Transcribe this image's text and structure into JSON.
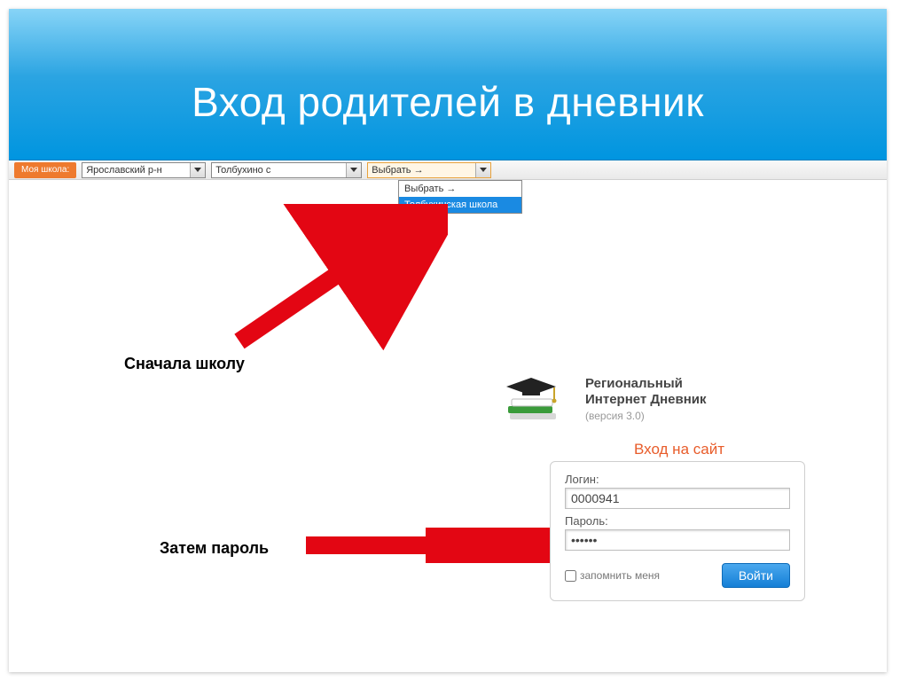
{
  "header": {
    "title": "Вход родителей в дневник"
  },
  "selector_bar": {
    "label": "Моя школа:",
    "select1_value": "Ярославский р-н",
    "select2_value": "Толбухино с",
    "select3_value": "Выбрать →",
    "dropdown": {
      "option1": "Выбрать →",
      "option2_selected": "Толбухинская школа"
    }
  },
  "annotations": {
    "first": "Сначала школу",
    "second": "Затем пароль"
  },
  "brand": {
    "line1": "Региональный",
    "line2": "Интернет Дневник",
    "version": "(версия 3.0)"
  },
  "login": {
    "heading": "Вход на сайт",
    "login_label": "Логин:",
    "login_value": "0000941",
    "password_label": "Пароль:",
    "password_value": "••••••",
    "remember_label": "запомнить меня",
    "submit_label": "Войти"
  }
}
